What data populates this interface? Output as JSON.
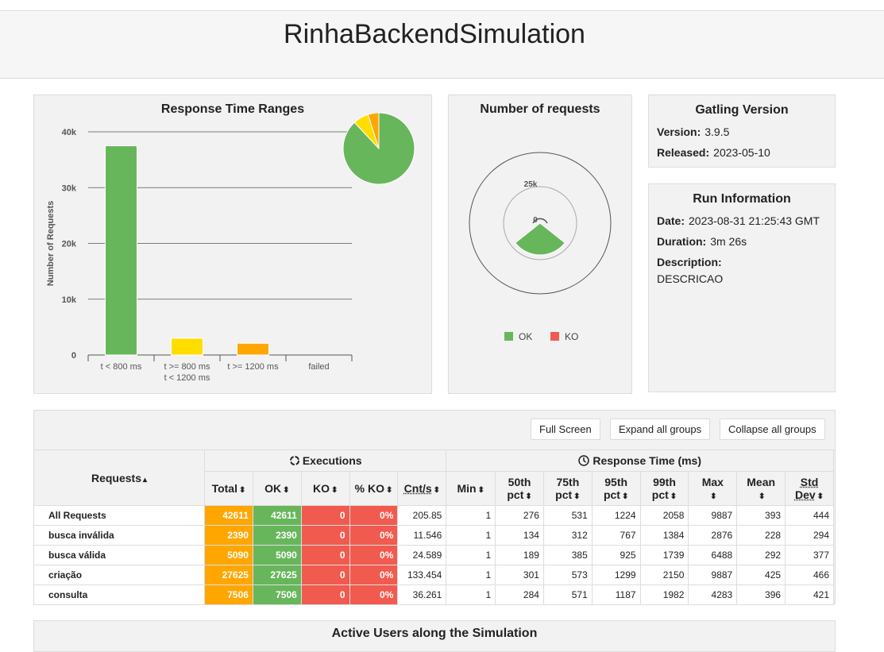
{
  "title": "RinhaBackendSimulation",
  "colors": {
    "ok": "#68b65c",
    "ko": "#f15b4f",
    "green": "#68b65c",
    "yellow": "#ffdd00",
    "orange": "#ffa600",
    "red": "#f15b4f"
  },
  "response_time_ranges": {
    "title": "Response Time Ranges",
    "ylabel": "Number of Requests",
    "yticks": [
      "0",
      "10k",
      "20k",
      "30k",
      "40k"
    ],
    "bars": [
      {
        "label": [
          "t < 800 ms"
        ],
        "color": "#68b65c"
      },
      {
        "label": [
          "t >= 800 ms",
          "t < 1200 ms"
        ],
        "color": "#ffdd00"
      },
      {
        "label": [
          "t >= 1200 ms"
        ],
        "color": "#ffa600"
      },
      {
        "label": [
          "failed"
        ],
        "color": "#f15b4f"
      }
    ]
  },
  "chart_data": [
    {
      "type": "bar",
      "title": "Response Time Ranges",
      "categories": [
        "t < 800 ms",
        "t >= 800 ms t < 1200 ms",
        "t >= 1200 ms",
        "failed"
      ],
      "values": [
        37500,
        3000,
        2100,
        0
      ],
      "ylabel": "Number of Requests",
      "ylim": [
        0,
        40000
      ],
      "grid": true
    },
    {
      "type": "pie",
      "title": "",
      "categories": [
        "t < 800 ms",
        "t >= 800 ms t < 1200 ms",
        "t >= 1200 ms",
        "failed"
      ],
      "values": [
        37500,
        3000,
        2100,
        0
      ]
    },
    {
      "type": "pie",
      "title": "Number of requests",
      "categories": [
        "OK",
        "KO"
      ],
      "values": [
        42611,
        0
      ],
      "ytick": "25k",
      "center_label": "0",
      "legend": [
        "OK",
        "KO"
      ],
      "legend_position": "bottom"
    }
  ],
  "number_of_requests": {
    "title": "Number of requests",
    "tick": "25k",
    "center": "0",
    "legend": [
      {
        "label": "OK",
        "color": "#68b65c"
      },
      {
        "label": "KO",
        "color": "#f15b4f"
      }
    ]
  },
  "gatling": {
    "title": "Gatling Version",
    "version_label": "Version:",
    "version": "3.9.5",
    "released_label": "Released:",
    "released": "2023-05-10"
  },
  "run": {
    "title": "Run Information",
    "date_label": "Date:",
    "date": "2023-08-31 21:25:43 GMT",
    "duration_label": "Duration:",
    "duration": "3m 26s",
    "description_label": "Description:",
    "description": "DESCRICAO"
  },
  "buttons": {
    "full_screen": "Full Screen",
    "expand": "Expand all groups",
    "collapse": "Collapse all groups"
  },
  "table": {
    "requests_header": "Requests",
    "executions_header": "Executions",
    "response_time_header": "Response Time (ms)",
    "columns": [
      "Total",
      "OK",
      "KO",
      "% KO",
      "Cnt/s",
      "Min",
      "50th pct",
      "75th pct",
      "95th pct",
      "99th pct",
      "Max",
      "Mean",
      "Std Dev"
    ],
    "rows": [
      {
        "name": "All Requests",
        "cells": [
          "42611",
          "42611",
          "0",
          "0%",
          "205.85",
          "1",
          "276",
          "531",
          "1224",
          "2058",
          "9887",
          "393",
          "444"
        ]
      },
      {
        "name": "busca inválida",
        "cells": [
          "2390",
          "2390",
          "0",
          "0%",
          "11.546",
          "1",
          "134",
          "312",
          "767",
          "1384",
          "2876",
          "228",
          "294"
        ]
      },
      {
        "name": "busca válida",
        "cells": [
          "5090",
          "5090",
          "0",
          "0%",
          "24.589",
          "1",
          "189",
          "385",
          "925",
          "1739",
          "6488",
          "292",
          "377"
        ]
      },
      {
        "name": "criação",
        "cells": [
          "27625",
          "27625",
          "0",
          "0%",
          "133.454",
          "1",
          "301",
          "573",
          "1299",
          "2150",
          "9887",
          "425",
          "466"
        ]
      },
      {
        "name": "consulta",
        "cells": [
          "7506",
          "7506",
          "0",
          "0%",
          "36.261",
          "1",
          "284",
          "571",
          "1187",
          "1982",
          "4283",
          "396",
          "421"
        ]
      }
    ]
  },
  "active_users": {
    "title": "Active Users along the Simulation"
  }
}
